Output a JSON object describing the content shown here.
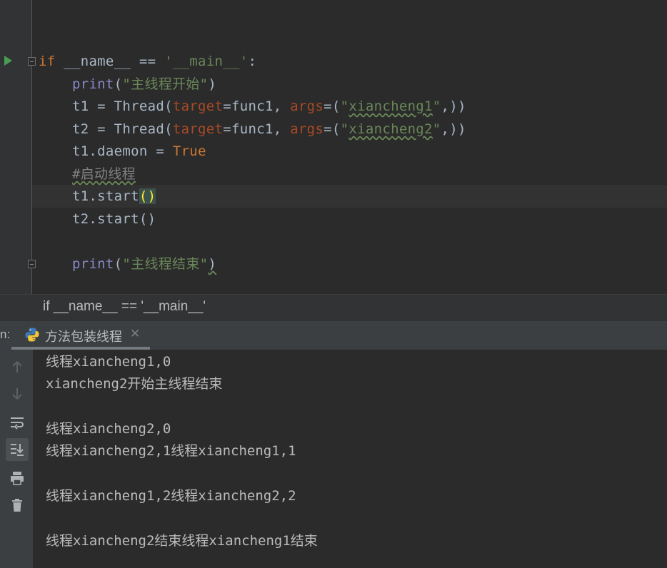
{
  "editor": {
    "lines": [
      {
        "tokens": [
          {
            "t": "kw",
            "v": "if"
          },
          {
            "t": "cls",
            "v": " __name__ == "
          },
          {
            "t": "str",
            "v": "'__main__'"
          },
          {
            "t": "cls",
            "v": ":"
          }
        ]
      },
      {
        "tokens": [
          {
            "t": "cls",
            "v": "    "
          },
          {
            "t": "fn",
            "v": "print"
          },
          {
            "t": "cls",
            "v": "("
          },
          {
            "t": "str",
            "v": "\"主线程开始\""
          },
          {
            "t": "cls",
            "v": ")"
          }
        ]
      },
      {
        "tokens": [
          {
            "t": "cls",
            "v": "    t1 = Thread("
          },
          {
            "t": "param",
            "v": "target"
          },
          {
            "t": "cls",
            "v": "=func1, "
          },
          {
            "t": "param",
            "v": "args"
          },
          {
            "t": "cls",
            "v": "=("
          },
          {
            "t": "str",
            "v": "\""
          },
          {
            "t": "str typo",
            "v": "xiancheng1"
          },
          {
            "t": "str",
            "v": "\""
          },
          {
            "t": "cls",
            "v": ",))"
          }
        ]
      },
      {
        "tokens": [
          {
            "t": "cls",
            "v": "    t2 = Thread("
          },
          {
            "t": "param",
            "v": "target"
          },
          {
            "t": "cls",
            "v": "=func1, "
          },
          {
            "t": "param",
            "v": "args"
          },
          {
            "t": "cls",
            "v": "=("
          },
          {
            "t": "str",
            "v": "\""
          },
          {
            "t": "str typo",
            "v": "xiancheng2"
          },
          {
            "t": "str",
            "v": "\""
          },
          {
            "t": "cls",
            "v": ",))"
          }
        ]
      },
      {
        "tokens": [
          {
            "t": "cls",
            "v": "    t1.daemon = "
          },
          {
            "t": "kw",
            "v": "True"
          }
        ]
      },
      {
        "tokens": [
          {
            "t": "cls",
            "v": "    "
          },
          {
            "t": "cmt typo",
            "v": "#启动线程"
          }
        ]
      },
      {
        "tokens": [
          {
            "t": "cls",
            "v": "    t1.start"
          },
          {
            "t": "paren-hl",
            "v": "()"
          }
        ]
      },
      {
        "tokens": [
          {
            "t": "cls",
            "v": "    t2.start()"
          }
        ]
      },
      {
        "tokens": [
          {
            "t": "cls",
            "v": ""
          }
        ]
      },
      {
        "tokens": [
          {
            "t": "cls",
            "v": "    "
          },
          {
            "t": "fn",
            "v": "print"
          },
          {
            "t": "cls",
            "v": "("
          },
          {
            "t": "str",
            "v": "\"主线程结束\""
          },
          {
            "t": "cls typo",
            "v": ")"
          }
        ]
      }
    ]
  },
  "breadcrumb": {
    "text": "if __name__ == '__main__'"
  },
  "run_panel": {
    "prefix": "n:",
    "tab_label": "方法包装线程",
    "close_glyph": "✕",
    "output": [
      "线程xiancheng1,0",
      "xiancheng2开始主线程结束",
      "",
      "线程xiancheng2,0",
      "线程xiancheng2,1线程xiancheng1,1",
      "",
      "线程xiancheng1,2线程xiancheng2,2",
      "",
      "线程xiancheng2结束线程xiancheng1结束"
    ]
  },
  "icons": {
    "run": "run-icon",
    "toolbar": [
      "arrow-up-icon",
      "arrow-down-icon",
      "soft-wrap-icon",
      "scroll-to-end-icon",
      "print-icon",
      "trash-icon"
    ]
  },
  "colors": {
    "keyword": "#cc7832",
    "string": "#6a8759",
    "param": "#aa4926",
    "builtin": "#8888c6",
    "comment": "#808080",
    "run_icon": "#499c54"
  }
}
